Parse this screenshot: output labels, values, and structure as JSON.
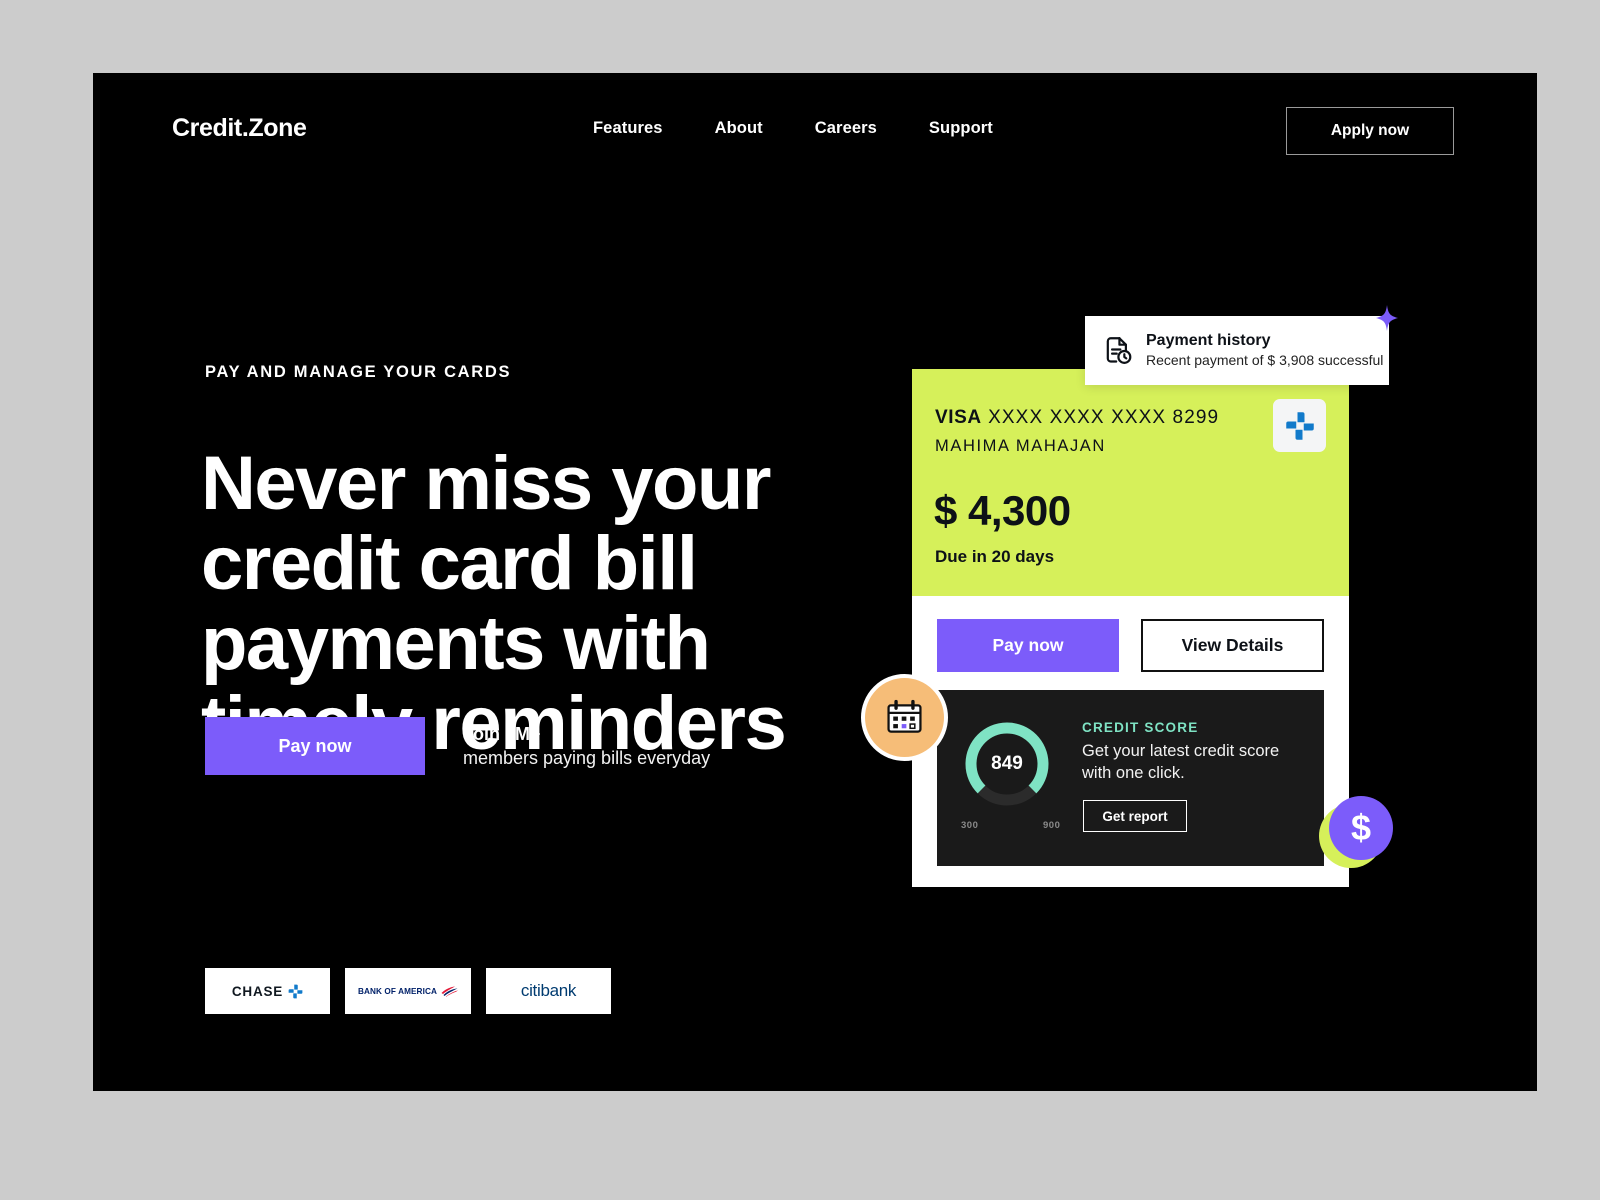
{
  "brand": {
    "logo": "Credit.Zone",
    "accent_purple": "#7c5cfa",
    "accent_green": "#d6f05a",
    "accent_mint": "#7fe3c4",
    "page_background": "#000000",
    "outer_background": "#cccccc"
  },
  "header": {
    "nav": [
      {
        "label": "Features"
      },
      {
        "label": "About"
      },
      {
        "label": "Careers"
      },
      {
        "label": "Support"
      }
    ],
    "apply_label": "Apply now"
  },
  "hero": {
    "eyebrow": "PAY AND MANAGE YOUR CARDS",
    "headline": "Never miss your credit card bill payments with timely reminders",
    "cta_label": "Pay now",
    "join_title": "Join 8M+",
    "join_sub": "members paying bills everyday"
  },
  "banks": [
    {
      "name": "CHASE",
      "icon": "chase-logo-icon"
    },
    {
      "name": "BANK OF AMERICA",
      "icon": "bank-of-america-logo-icon"
    },
    {
      "name": "citibank",
      "icon": "citibank-logo-icon"
    }
  ],
  "toast": {
    "icon": "payment-history-icon",
    "title": "Payment history",
    "subtitle": "Recent payment of $ 3,908 successful",
    "sparkle_icon": "sparkle-icon",
    "sparkle_color": "#7c5cfa"
  },
  "card": {
    "network": "VISA",
    "number": "XXXX XXXX XXXX 8299",
    "holder": "MAHIMA MAHAJAN",
    "amount": "$ 4,300",
    "due": "Due in 20 days",
    "issuer_icon": "chase-logo-icon",
    "pay_label": "Pay now",
    "details_label": "View Details"
  },
  "score": {
    "label": "CREDIT SCORE",
    "description": "Get your latest credit score with one click.",
    "button_label": "Get report",
    "value": "849",
    "min": "300",
    "max": "900"
  },
  "badges": {
    "calendar_icon": "calendar-icon",
    "dollar_icon": "dollar-icon",
    "dollar_glyph": "$"
  },
  "chart_data": {
    "type": "gauge",
    "title": "CREDIT SCORE",
    "value": 849,
    "min": 300,
    "max": 900,
    "tick_labels": [
      "300",
      "900"
    ],
    "arc_color": "#7fe3c4",
    "track_color": "#2b2b2b",
    "sweep_degrees": 300,
    "start_angle_degrees": 210
  }
}
